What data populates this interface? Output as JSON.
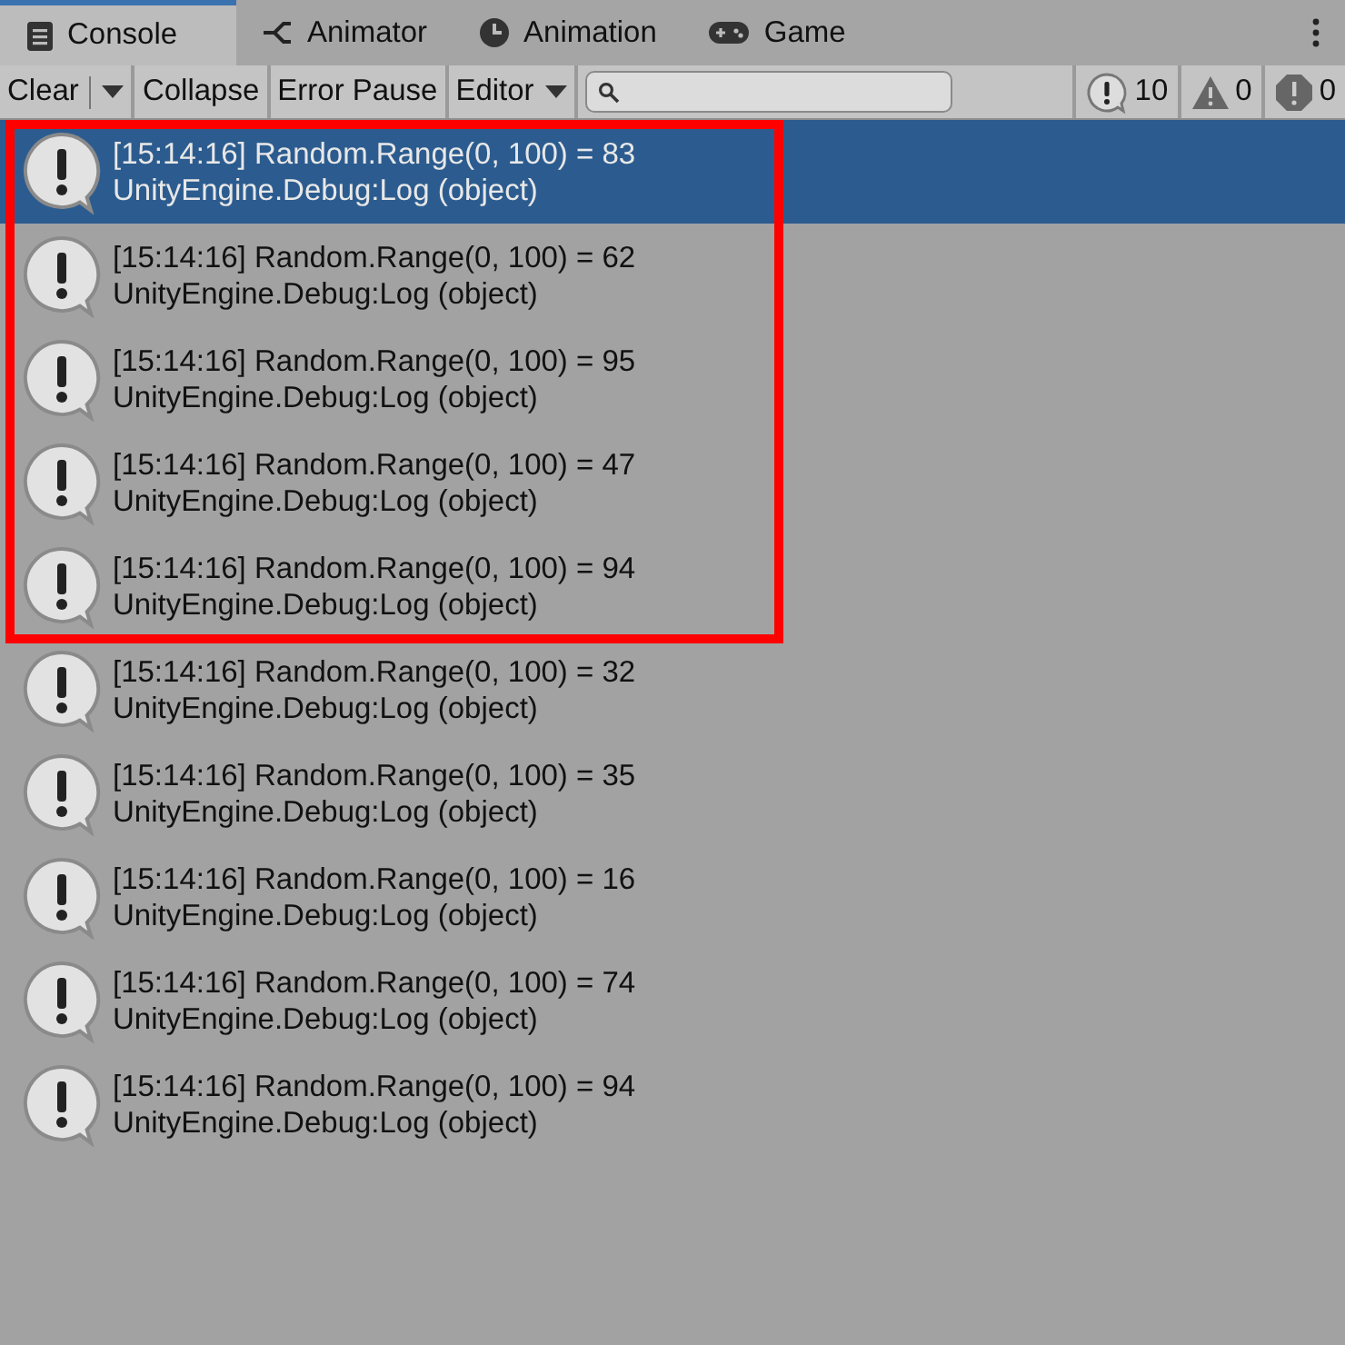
{
  "tabs": [
    {
      "label": "Console",
      "kind": "console",
      "selected": true
    },
    {
      "label": "Animator",
      "kind": "animator",
      "selected": false
    },
    {
      "label": "Animation",
      "kind": "animation",
      "selected": false
    },
    {
      "label": "Game",
      "kind": "game",
      "selected": false
    }
  ],
  "toolbar": {
    "buttons": [
      {
        "label": "Clear",
        "kind": "split"
      },
      {
        "label": "Collapse",
        "kind": "plain"
      },
      {
        "label": "Error Pause",
        "kind": "plain"
      },
      {
        "label": "Editor",
        "kind": "dropdown"
      }
    ],
    "counters": [
      {
        "kind": "log",
        "count": "10"
      },
      {
        "kind": "warning",
        "count": "0"
      },
      {
        "kind": "error",
        "count": "0"
      }
    ]
  },
  "entries": [
    {
      "message": "[15:14:16] Random.Range(0, 100) = 83",
      "source": "UnityEngine.Debug:Log (object)",
      "selected": true,
      "highlighted": true
    },
    {
      "message": "[15:14:16] Random.Range(0, 100) = 62",
      "source": "UnityEngine.Debug:Log (object)",
      "selected": false,
      "highlighted": true
    },
    {
      "message": "[15:14:16] Random.Range(0, 100) = 95",
      "source": "UnityEngine.Debug:Log (object)",
      "selected": false,
      "highlighted": true
    },
    {
      "message": "[15:14:16] Random.Range(0, 100) = 47",
      "source": "UnityEngine.Debug:Log (object)",
      "selected": false,
      "highlighted": true
    },
    {
      "message": "[15:14:16] Random.Range(0, 100) = 94",
      "source": "UnityEngine.Debug:Log (object)",
      "selected": false,
      "highlighted": true
    },
    {
      "message": "[15:14:16] Random.Range(0, 100) = 32",
      "source": "UnityEngine.Debug:Log (object)",
      "selected": false,
      "highlighted": false
    },
    {
      "message": "[15:14:16] Random.Range(0, 100) = 35",
      "source": "UnityEngine.Debug:Log (object)",
      "selected": false,
      "highlighted": false
    },
    {
      "message": "[15:14:16] Random.Range(0, 100) = 16",
      "source": "UnityEngine.Debug:Log (object)",
      "selected": false,
      "highlighted": false
    },
    {
      "message": "[15:14:16] Random.Range(0, 100) = 74",
      "source": "UnityEngine.Debug:Log (object)",
      "selected": false,
      "highlighted": false
    },
    {
      "message": "[15:14:16] Random.Range(0, 100) = 94",
      "source": "UnityEngine.Debug:Log (object)",
      "selected": false,
      "highlighted": false
    }
  ]
}
